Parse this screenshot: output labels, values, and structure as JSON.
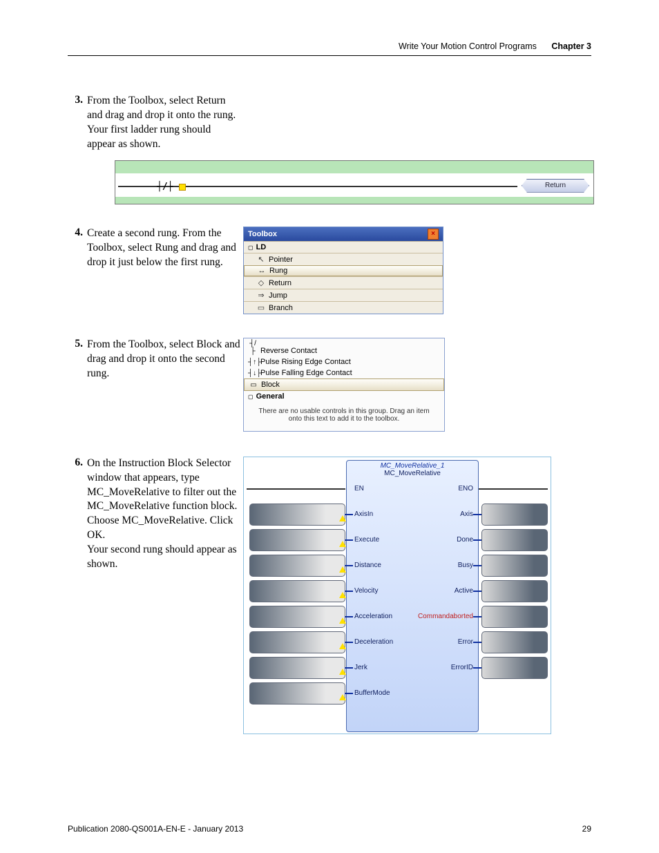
{
  "header": {
    "title": "Write Your Motion Control Programs",
    "chapter": "Chapter 3"
  },
  "steps": [
    {
      "num": "3.",
      "text_line1": "From the Toolbox, select Return and drag and drop it onto the rung.",
      "text_line2": "Your first ladder rung should appear as shown."
    },
    {
      "num": "4.",
      "text": "Create a second rung. From the Toolbox, select Rung and drag and drop it just below the first rung."
    },
    {
      "num": "5.",
      "text": "From the Toolbox, select Block and drag and drop it onto the second rung."
    },
    {
      "num": "6.",
      "text_line1": "On the Instruction Block Selector window that appears, type MC_MoveRelative to filter out the MC_MoveRelative function block. Choose MC_MoveRelative. Click OK.",
      "text_line2": "Your second rung should appear as shown."
    }
  ],
  "rung": {
    "contact_symbol": "┤/├",
    "return_label": "Return"
  },
  "toolbox": {
    "title": "Toolbox",
    "header": "LD",
    "items": [
      {
        "icon": "↖",
        "label": "Pointer"
      },
      {
        "icon": "↔",
        "label": "Rung",
        "selected": true
      },
      {
        "icon": "◇",
        "label": "Return"
      },
      {
        "icon": "⇒",
        "label": "Jump"
      },
      {
        "icon": "▭",
        "label": "Branch"
      }
    ]
  },
  "blocklist": {
    "items": [
      {
        "icon": "┤/├",
        "label": "Reverse Contact"
      },
      {
        "icon": "┤↑├",
        "label": "Pulse Rising Edge Contact"
      },
      {
        "icon": "┤↓├",
        "label": "Pulse Falling Edge Contact"
      },
      {
        "icon": "▭",
        "label": "Block",
        "selected": true
      }
    ],
    "general_header": "General",
    "note": "There are no usable controls in this group. Drag an item onto this text to add it to the toolbox."
  },
  "function_block": {
    "instance": "MC_MoveRelative_1",
    "type": "MC_MoveRelative",
    "top_left": "EN",
    "top_right": "ENO",
    "inputs": [
      "AxisIn",
      "Execute",
      "Distance",
      "Velocity",
      "Acceleration",
      "Deceleration",
      "Jerk",
      "BufferMode"
    ],
    "outputs": [
      "Axis",
      "Done",
      "Busy",
      "Active",
      "Commandaborted",
      "Error",
      "ErrorID"
    ]
  },
  "footer": {
    "pub": "Publication 2080-QS001A-EN-E - January 2013",
    "page": "29"
  }
}
